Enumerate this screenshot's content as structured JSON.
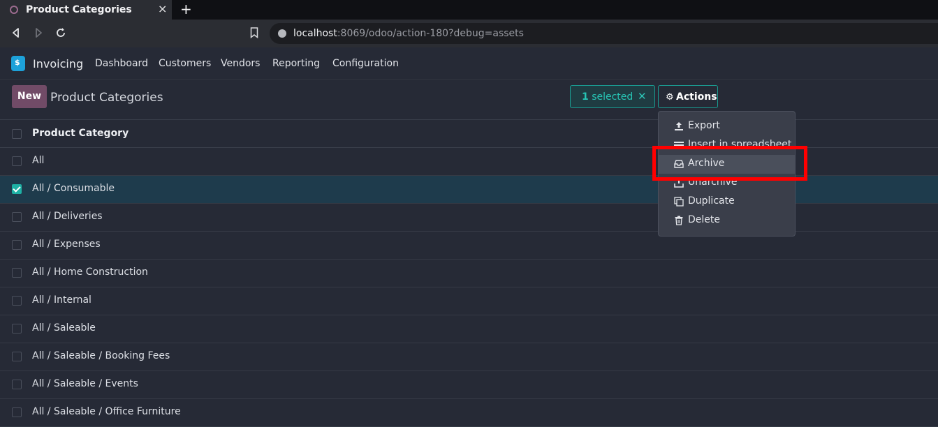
{
  "browser": {
    "tab_title": "Product Categories",
    "close_glyph": "×",
    "new_tab_glyph": "+",
    "url_host": "localhost",
    "url_rest": ":8069/odoo/action-180?debug=assets"
  },
  "app": {
    "logo_letter": "$",
    "name": "Invoicing",
    "menu": [
      "Dashboard",
      "Customers",
      "Vendors",
      "Reporting",
      "Configuration"
    ]
  },
  "control": {
    "new_label": "New",
    "title": "Product Categories",
    "selected_count": "1",
    "selected_text": " selected",
    "clear_glyph": "✕",
    "actions_label": "Actions",
    "gear_glyph": "⚙"
  },
  "list": {
    "column_header": "Product Category",
    "rows": [
      "All",
      "All / Consumable",
      "All / Deliveries",
      "All / Expenses",
      "All / Home Construction",
      "All / Internal",
      "All / Saleable",
      "All / Saleable / Booking Fees",
      "All / Saleable / Events",
      "All / Saleable / Office Furniture"
    ],
    "selected_row_index": 1
  },
  "actions_menu": {
    "items": [
      "Export",
      "Insert in spreadsheet",
      "Archive",
      "Unarchive",
      "Duplicate",
      "Delete"
    ],
    "icons": [
      "upload-icon",
      "list-icon",
      "inbox-icon",
      "unarchive-icon",
      "copy-icon",
      "trash-icon"
    ],
    "highlighted_index": 2
  },
  "colors": {
    "accent_teal": "#1eb1a5",
    "brand_purple": "#714b67",
    "highlight_red": "#ff0000"
  }
}
